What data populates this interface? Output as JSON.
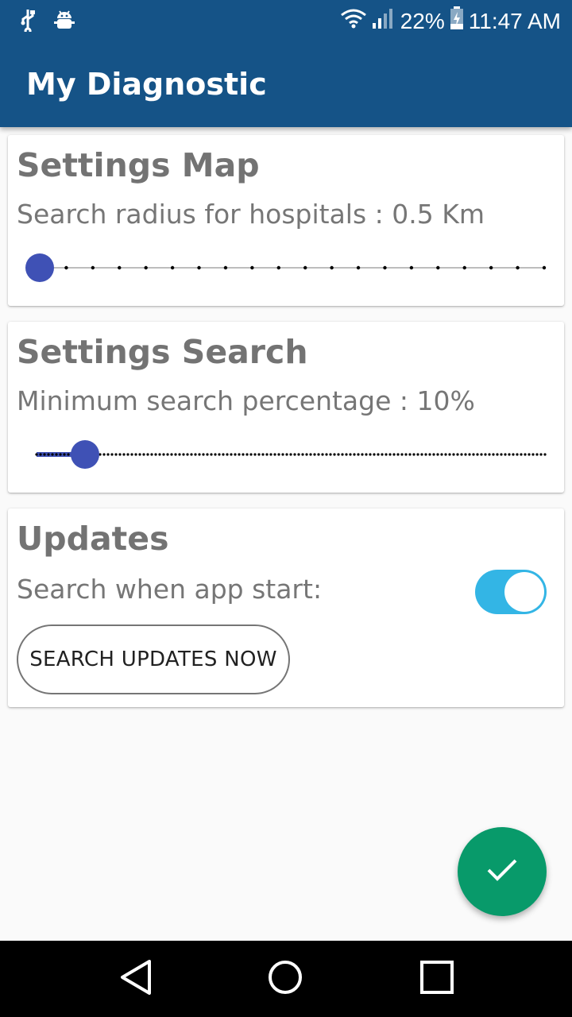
{
  "status_bar": {
    "battery": "22%",
    "time": "11:47 AM",
    "icons": [
      "usb-icon",
      "android-debug-icon",
      "wifi-icon",
      "signal-icon",
      "battery-charging-icon"
    ]
  },
  "app_bar": {
    "title": "My Diagnostic"
  },
  "settings_map": {
    "title": "Settings Map",
    "label": "Search radius for hospitals : 0.5 Km",
    "slider_value_index": 0,
    "slider_steps": 20
  },
  "settings_search": {
    "title": "Settings Search",
    "label": "Minimum search percentage : 10%",
    "slider_value_percent": 10
  },
  "updates": {
    "title": "Updates",
    "search_on_start_label": "Search when app start:",
    "search_on_start_enabled": true,
    "search_now_button": "SEARCH UPDATES NOW"
  },
  "fab": {
    "icon": "check-icon",
    "color": "#089a6a"
  },
  "nav_bar": {
    "buttons": [
      "back-icon",
      "home-icon",
      "recents-icon"
    ]
  },
  "colors": {
    "primary": "#155387",
    "accent_slider": "#3f51b5",
    "switch_on": "#33b5e5"
  }
}
